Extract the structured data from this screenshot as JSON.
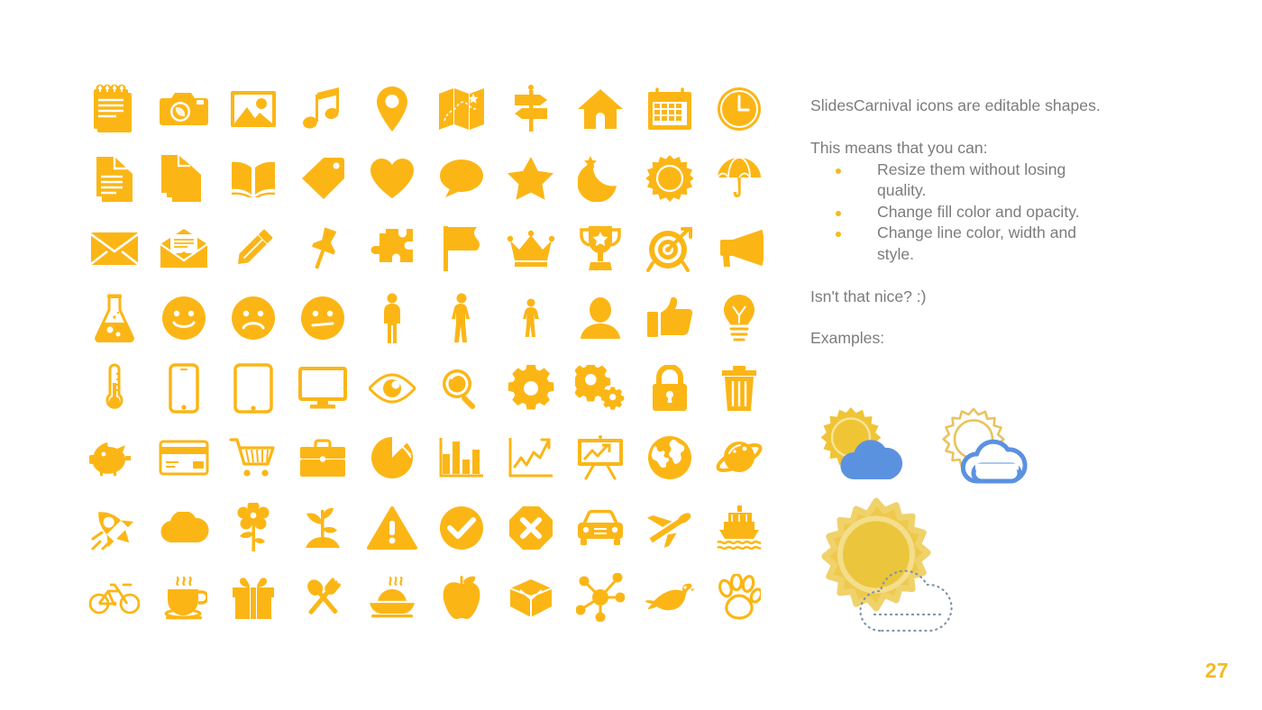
{
  "slide": {
    "page_number": "27",
    "accent_color": "#F5B921",
    "icon_color": "#FBB616",
    "text_color": "#7c7c7c",
    "background_color": "#ffffff"
  },
  "body": {
    "intro": "SlidesCarnival icons are editable shapes.",
    "lead_in": "This means that you can:",
    "bullets": [
      "Resize them without losing quality.",
      "Change fill color and opacity.",
      "Change line color, width and style."
    ],
    "closing": "Isn't that nice? :)",
    "examples_label": "Examples:"
  },
  "examples": {
    "sun_fill_color": "#EFC536",
    "cloud_fill_color": "#5B92E0",
    "sun_outline_color": "#E8C45C",
    "cloud_outline_color": "#5B92E0",
    "big_sun_outer_color": "#EFC94C",
    "big_sun_inner_color": "#EBC63C",
    "dotted_outline_color": "#7f93a8",
    "items": [
      {
        "name": "sun-behind-cloud-filled"
      },
      {
        "name": "sun-behind-cloud-outline"
      },
      {
        "name": "sun-with-dotted-cloud"
      }
    ]
  },
  "icon_grid": {
    "columns": 10,
    "rows": 8,
    "icons": [
      "notepad-icon",
      "camera-icon",
      "photo-icon",
      "music-note-icon",
      "location-pin-icon",
      "map-icon",
      "signpost-icon",
      "home-icon",
      "calendar-icon",
      "clock-icon",
      "document-icon",
      "documents-stack-icon",
      "open-book-icon",
      "tag-icon",
      "heart-icon",
      "speech-bubble-icon",
      "star-icon",
      "moon-star-icon",
      "sun-icon",
      "umbrella-icon",
      "envelope-icon",
      "open-envelope-icon",
      "pencil-icon",
      "pushpin-icon",
      "puzzle-piece-icon",
      "flag-icon",
      "crown-icon",
      "trophy-icon",
      "target-icon",
      "megaphone-icon",
      "flask-icon",
      "smiley-happy-icon",
      "smiley-sad-icon",
      "smiley-neutral-icon",
      "person-icon",
      "person-standing-icon",
      "child-icon",
      "user-avatar-icon",
      "thumbs-up-icon",
      "lightbulb-icon",
      "thermometer-icon",
      "smartphone-icon",
      "tablet-icon",
      "monitor-icon",
      "eye-icon",
      "magnifier-icon",
      "gear-icon",
      "gears-icon",
      "lock-icon",
      "trash-icon",
      "piggy-bank-icon",
      "credit-card-icon",
      "shopping-cart-icon",
      "briefcase-icon",
      "pie-chart-icon",
      "bar-chart-icon",
      "line-chart-icon",
      "presentation-chart-icon",
      "globe-icon",
      "planet-icon",
      "rocket-icon",
      "cloud-icon",
      "flower-icon",
      "sprout-icon",
      "warning-triangle-icon",
      "check-circle-icon",
      "x-octagon-icon",
      "car-icon",
      "airplane-icon",
      "ship-icon",
      "bicycle-icon",
      "coffee-cup-icon",
      "gift-icon",
      "cutlery-icon",
      "food-bowl-icon",
      "apple-icon",
      "open-box-icon",
      "network-icon",
      "bird-icon",
      "paw-print-icon"
    ]
  }
}
